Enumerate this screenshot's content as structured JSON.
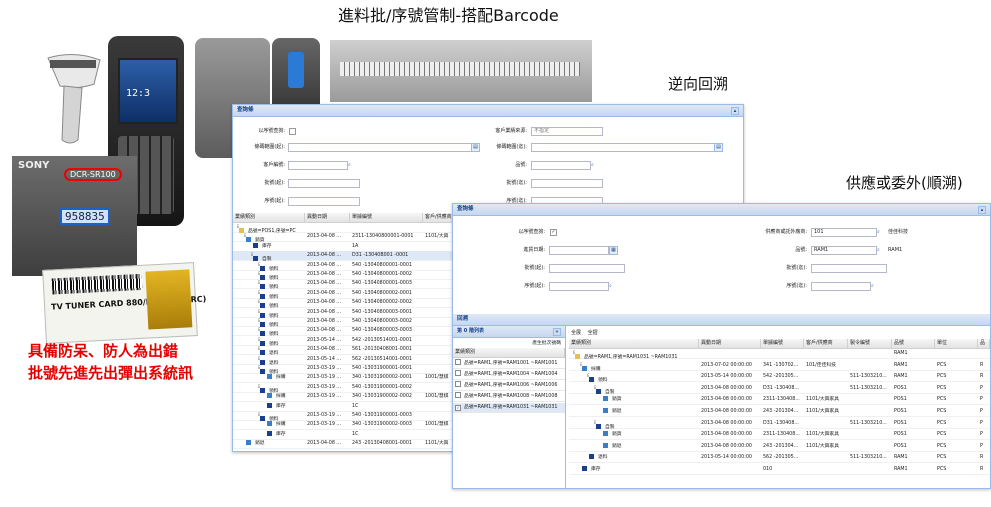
{
  "titles": {
    "main": "進料批/序號管制-搭配Barcode",
    "back_trace": "逆向回溯",
    "forward_trace": "供應或委外(順溯)"
  },
  "red_note": {
    "line1": "具備防呆、防人為出錯",
    "line2": "批號先進先出彈出系統訊"
  },
  "devices": {
    "pda_time": "12:3",
    "sony_brand": "SONY",
    "sony_model": "DCR-SR100",
    "sony_serial": "958835",
    "label_text": "TV TUNER CARD 880/NTSC(W/I RC)"
  },
  "colors": {
    "accent": "#15428b",
    "panel_border": "#99bbe8",
    "red": "#e60000"
  },
  "back_trace_screen": {
    "header": "查詢條",
    "form": {
      "only_in_stock_label": "以序號查詢:",
      "scan_range_label": "條碼範圍(起):",
      "customer_label": "客戶編號:",
      "batch_from_label": "批號(起):",
      "serial_from_label": "序號(起):",
      "customer_type_label": "客戶業績來源:",
      "customer_type_value": "不指定",
      "scan_range_to_label": "條碼範圍(迄):",
      "product_label": "品號:",
      "batch_to_label": "批號(迄):",
      "serial_to_label": "序號(迄):"
    },
    "grid": {
      "headers": [
        "業績類別",
        "異動日期",
        "單據編號",
        "客戶/供應商"
      ],
      "rows": [
        {
          "indent": 0,
          "toggle": "⊟",
          "icon": "folder",
          "type": "品號=POS1,序號=PC",
          "date": "",
          "doc": "",
          "party": ""
        },
        {
          "indent": 1,
          "toggle": "⊟",
          "icon": "truck",
          "type": "銷貨",
          "date": "2013-04-08 ...",
          "doc": "2311-13040800001-0001",
          "party": "1101/大興"
        },
        {
          "indent": 2,
          "toggle": "",
          "icon": "box",
          "type": "庫存",
          "date": "",
          "doc": "1A",
          "party": ""
        },
        {
          "indent": 2,
          "toggle": "⊟",
          "icon": "box",
          "type": "自製",
          "date": "2013-04-08 ...",
          "doc": "D31 -13040B001 -0001",
          "party": "",
          "selected": true
        },
        {
          "indent": 3,
          "toggle": "⊞",
          "icon": "box",
          "type": "領料",
          "date": "2013-04-08 ...",
          "doc": "540 -13040800001-0001",
          "party": ""
        },
        {
          "indent": 3,
          "toggle": "⊞",
          "icon": "box",
          "type": "領料",
          "date": "2013-04-08 ...",
          "doc": "540 -13040800001-0002",
          "party": ""
        },
        {
          "indent": 3,
          "toggle": "⊞",
          "icon": "box",
          "type": "領料",
          "date": "2013-04-08 ...",
          "doc": "540 -13040800001-0003",
          "party": ""
        },
        {
          "indent": 3,
          "toggle": "⊞",
          "icon": "box",
          "type": "領料",
          "date": "2013-04-08 ...",
          "doc": "540 -13040800002-0001",
          "party": ""
        },
        {
          "indent": 3,
          "toggle": "⊞",
          "icon": "box",
          "type": "領料",
          "date": "2013-04-08 ...",
          "doc": "540 -13040800002-0002",
          "party": ""
        },
        {
          "indent": 3,
          "toggle": "⊞",
          "icon": "box",
          "type": "領料",
          "date": "2013-04-08 ...",
          "doc": "540 -13040800003-0001",
          "party": ""
        },
        {
          "indent": 3,
          "toggle": "⊞",
          "icon": "box",
          "type": "領料",
          "date": "2013-04-08 ...",
          "doc": "540 -13040800003-0002",
          "party": ""
        },
        {
          "indent": 3,
          "toggle": "⊞",
          "icon": "box",
          "type": "領料",
          "date": "2013-04-08 ...",
          "doc": "540 -13040800003-0003",
          "party": ""
        },
        {
          "indent": 3,
          "toggle": "⊞",
          "icon": "box",
          "type": "領料",
          "date": "2013-05-14 ...",
          "doc": "542 -20130514001-0001",
          "party": ""
        },
        {
          "indent": 3,
          "toggle": "⊞",
          "icon": "box",
          "type": "退料",
          "date": "2013-04-08 ...",
          "doc": "561 -20130408001-0001",
          "party": ""
        },
        {
          "indent": 3,
          "toggle": "⊞",
          "icon": "box",
          "type": "退料",
          "date": "2013-05-14 ...",
          "doc": "562 -20130514001-0001",
          "party": ""
        },
        {
          "indent": 3,
          "toggle": "⊟",
          "icon": "box",
          "type": "領料",
          "date": "2013-03-19 ...",
          "doc": "540 -13031900001-0001",
          "party": ""
        },
        {
          "indent": 4,
          "toggle": "",
          "icon": "truck",
          "type": "採購",
          "date": "2013-03-19 ...",
          "doc": "340 -13031900002-0001",
          "party": "1001/慧棋"
        },
        {
          "indent": 3,
          "toggle": "⊟",
          "icon": "box",
          "type": "領料",
          "date": "2013-03-19 ...",
          "doc": "540 -13031900001-0002",
          "party": ""
        },
        {
          "indent": 4,
          "toggle": "",
          "icon": "truck",
          "type": "採購",
          "date": "2013-03-19 ...",
          "doc": "340 -13031900002-0002",
          "party": "1001/慧棋"
        },
        {
          "indent": 4,
          "toggle": "",
          "icon": "box",
          "type": "庫存",
          "date": "",
          "doc": "1C",
          "party": ""
        },
        {
          "indent": 3,
          "toggle": "⊟",
          "icon": "box",
          "type": "領料",
          "date": "2013-03-19 ...",
          "doc": "540 -13031900001-0003",
          "party": ""
        },
        {
          "indent": 4,
          "toggle": "",
          "icon": "truck",
          "type": "採購",
          "date": "2013-03-19 ...",
          "doc": "340 -13031900002-0003",
          "party": "1001/慧棋"
        },
        {
          "indent": 4,
          "toggle": "",
          "icon": "box",
          "type": "庫存",
          "date": "",
          "doc": "1C",
          "party": ""
        },
        {
          "indent": 1,
          "toggle": "",
          "icon": "truck",
          "type": "銷退",
          "date": "2013-04-08 ...",
          "doc": "243 -20130408001-0001",
          "party": "1101/大興"
        }
      ]
    }
  },
  "forward_trace_screen": {
    "header": "查詢條",
    "form": {
      "only_in_stock_label": "以序號查詢:",
      "vendor_label": "供應商或託外廠商:",
      "vendor_value": "101",
      "vendor_name": "佳佳科技",
      "date_from_label": "進貨日期:",
      "product_label": "品號:",
      "product_value": "RAM1",
      "product_name": "RAM1",
      "batch_from_label": "批號(起):",
      "batch_to_label": "批號(迄):",
      "serial_from_label": "序號(起):",
      "serial_to_label": "序號(迄):"
    },
    "result_header": "回溯",
    "left_panel": {
      "title": "第 0 階列表",
      "toolbar": "產生批次號碼",
      "column": "業績類別",
      "items": [
        "品號=RAM1,序號=RAM1001 ~RAM1001",
        "品號=RAM1,序號=RAM1004 ~RAM1004",
        "品號=RAM1,序號=RAM1006 ~RAM1006",
        "品號=RAM1,序號=RAM1008 ~RAM1008",
        "品號=RAM1,序號=RAM1031 ~RAM1031"
      ]
    },
    "toolbar": {
      "expand": "全展",
      "collapse": "全摺"
    },
    "grid": {
      "headers": [
        "業績類別",
        "異動日期",
        "單據編號",
        "客戶/供應商",
        "製令編號",
        "品號",
        "單位",
        "品"
      ],
      "rows": [
        {
          "indent": 0,
          "toggle": "⊟",
          "icon": "folder",
          "type": "品號=RAM1,序號=RAM1031 ~RAM1031",
          "date": "",
          "doc": "",
          "party": "",
          "mo": "",
          "item": "RAM1",
          "unit": "",
          "x": ""
        },
        {
          "indent": 1,
          "toggle": "⊟",
          "icon": "truck",
          "type": "採購",
          "date": "2013-07-02 00:00:00",
          "doc": "341 -130702...",
          "party": "101/佳佳科技",
          "mo": "",
          "item": "RAM1",
          "unit": "PCS",
          "x": "R"
        },
        {
          "indent": 2,
          "toggle": "⊟",
          "icon": "box",
          "type": "領料",
          "date": "2013-05-14 00:00:00",
          "doc": "542 -201305...",
          "party": "",
          "mo": "511-1303210...",
          "item": "RAM1",
          "unit": "PCS",
          "x": "R"
        },
        {
          "indent": 3,
          "toggle": "⊟",
          "icon": "box",
          "type": "自製",
          "date": "2013-04-08 00:00:00",
          "doc": "D31 -130408...",
          "party": "",
          "mo": "511-1303210...",
          "item": "POS1",
          "unit": "PCS",
          "x": "P"
        },
        {
          "indent": 4,
          "toggle": "",
          "icon": "truck",
          "type": "銷貨",
          "date": "2013-04-08 00:00:00",
          "doc": "2311-130408...",
          "party": "1101/大興家具",
          "mo": "",
          "item": "POS1",
          "unit": "PCS",
          "x": "P"
        },
        {
          "indent": 4,
          "toggle": "",
          "icon": "truck",
          "type": "銷退",
          "date": "2013-04-08 00:00:00",
          "doc": "243 -201304...",
          "party": "1101/大興家具",
          "mo": "",
          "item": "POS1",
          "unit": "PCS",
          "x": "P"
        },
        {
          "indent": 3,
          "toggle": "⊟",
          "icon": "box",
          "type": "自製",
          "date": "2013-04-08 00:00:00",
          "doc": "D31 -130408...",
          "party": "",
          "mo": "511-1303210...",
          "item": "POS1",
          "unit": "PCS",
          "x": "P"
        },
        {
          "indent": 4,
          "toggle": "",
          "icon": "truck",
          "type": "銷貨",
          "date": "2013-04-08 00:00:00",
          "doc": "2311-130408...",
          "party": "1101/大興家具",
          "mo": "",
          "item": "POS1",
          "unit": "PCS",
          "x": "P"
        },
        {
          "indent": 4,
          "toggle": "",
          "icon": "truck",
          "type": "銷退",
          "date": "2013-04-08 00:00:00",
          "doc": "243 -201304...",
          "party": "1101/大興家具",
          "mo": "",
          "item": "POS1",
          "unit": "PCS",
          "x": "P"
        },
        {
          "indent": 2,
          "toggle": "",
          "icon": "box",
          "type": "退料",
          "date": "2013-05-14 00:00:00",
          "doc": "562 -201305...",
          "party": "",
          "mo": "511-1303210...",
          "item": "RAM1",
          "unit": "PCS",
          "x": "R"
        },
        {
          "indent": 1,
          "toggle": "",
          "icon": "box",
          "type": "庫存",
          "date": "",
          "doc": "010",
          "party": "",
          "mo": "",
          "item": "RAM1",
          "unit": "PCS",
          "x": "R"
        }
      ]
    }
  }
}
